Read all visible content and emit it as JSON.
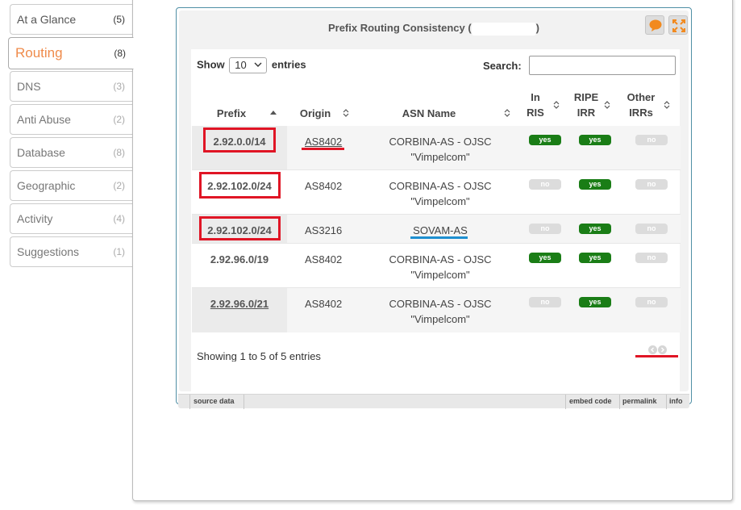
{
  "sidebar": {
    "tabs": [
      {
        "label": "At a Glance",
        "count": "(5)"
      },
      {
        "label": "Routing",
        "count": "(8)"
      },
      {
        "label": "DNS",
        "count": "(3)"
      },
      {
        "label": "Anti Abuse",
        "count": "(2)"
      },
      {
        "label": "Database",
        "count": "(8)"
      },
      {
        "label": "Geographic",
        "count": "(2)"
      },
      {
        "label": "Activity",
        "count": "(4)"
      },
      {
        "label": "Suggestions",
        "count": "(1)"
      }
    ]
  },
  "widget": {
    "title_prefix": "Prefix Routing Consistency (",
    "title_suffix": ")",
    "show_label": "Show",
    "page_size": "10",
    "entries_label": "entries",
    "search_label": "Search:",
    "search_value": "",
    "columns": {
      "prefix": "Prefix",
      "origin": "Origin",
      "asn_name": "ASN Name",
      "in_ris_1": "In",
      "in_ris_2": "RIS",
      "ripe_irr_1": "RIPE",
      "ripe_irr_2": "IRR",
      "other_irrs_1": "Other",
      "other_irrs_2": "IRRs"
    },
    "rows": [
      {
        "prefix": "2.92.0.0/14",
        "origin": "AS8402",
        "asn_name_1": "CORBINA-AS - OJSC",
        "asn_name_2": "\"Vimpelcom\"",
        "in_ris": "yes",
        "ripe_irr": "yes",
        "other_irrs": "no"
      },
      {
        "prefix": "2.92.102.0/24",
        "origin": "AS8402",
        "asn_name_1": "CORBINA-AS - OJSC",
        "asn_name_2": "\"Vimpelcom\"",
        "in_ris": "no",
        "ripe_irr": "yes",
        "other_irrs": "no"
      },
      {
        "prefix": "2.92.102.0/24",
        "origin": "AS3216",
        "asn_name_1": "SOVAM-AS",
        "asn_name_2": "",
        "in_ris": "no",
        "ripe_irr": "yes",
        "other_irrs": "no"
      },
      {
        "prefix": "2.92.96.0/19",
        "origin": "AS8402",
        "asn_name_1": "CORBINA-AS - OJSC",
        "asn_name_2": "\"Vimpelcom\"",
        "in_ris": "yes",
        "ripe_irr": "yes",
        "other_irrs": "no"
      },
      {
        "prefix": "2.92.96.0/21",
        "origin": "AS8402",
        "asn_name_1": "CORBINA-AS - OJSC",
        "asn_name_2": "\"Vimpelcom\"",
        "in_ris": "no",
        "ripe_irr": "yes",
        "other_irrs": "no"
      }
    ],
    "info": "Showing 1 to 5 of 5 entries",
    "footer": {
      "source": "source data",
      "embed": "embed code",
      "permalink": "permalink",
      "info": "info"
    }
  },
  "colors": {
    "active_tab": "#ef8b4b",
    "badge_yes": "#1a7d16",
    "badge_no": "#dcdcdc",
    "annotation_red": "#e01525",
    "annotation_blue": "#1e8fd0",
    "widget_border": "#4f8fa5"
  },
  "icons": [
    "feedback-icon",
    "fullscreen-icon",
    "sort-asc-icon",
    "sort-both-icon",
    "pager-prev-icon",
    "pager-next-icon",
    "select-chevron-icon"
  ]
}
